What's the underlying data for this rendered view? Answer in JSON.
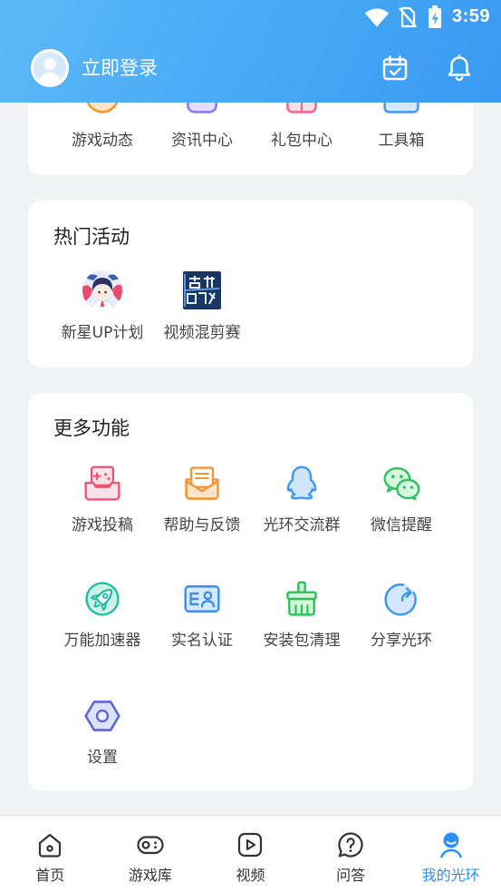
{
  "status_bar": {
    "time": "3:59",
    "icons": [
      "wifi-icon",
      "no-sim-icon",
      "battery-charging-icon"
    ]
  },
  "header": {
    "login_label": "立即登录",
    "avatar_icon": "avatar-icon",
    "right_icons": [
      "calendar-check-icon",
      "bell-icon"
    ]
  },
  "colors": {
    "header_gradient_start": "#5cb9f7",
    "header_gradient_end": "#3a9af3",
    "page_background": "#f2f3f5",
    "card_background": "#ffffff",
    "title_text": "#222222",
    "label_text": "#444444",
    "nav_active": "#2f8ff0",
    "nav_inactive": "#333333"
  },
  "quick_entries": {
    "items": [
      {
        "label": "游戏动态",
        "icon": "game-news-icon"
      },
      {
        "label": "资讯中心",
        "icon": "news-center-icon"
      },
      {
        "label": "礼包中心",
        "icon": "gift-center-icon"
      },
      {
        "label": "工具箱",
        "icon": "toolbox-icon"
      }
    ]
  },
  "hot_activities": {
    "title": "热门活动",
    "items": [
      {
        "label": "新星UP计划",
        "icon": "new-star-up-thumbnail"
      },
      {
        "label": "视频混剪赛",
        "icon": "video-remix-thumbnail"
      }
    ]
  },
  "more_features": {
    "title": "更多功能",
    "items": [
      {
        "label": "游戏投稿",
        "icon": "game-submit-icon"
      },
      {
        "label": "帮助与反馈",
        "icon": "help-feedback-icon"
      },
      {
        "label": "光环交流群",
        "icon": "group-chat-icon"
      },
      {
        "label": "微信提醒",
        "icon": "wechat-icon"
      },
      {
        "label": "万能加速器",
        "icon": "accelerator-icon"
      },
      {
        "label": "实名认证",
        "icon": "real-name-icon"
      },
      {
        "label": "安装包清理",
        "icon": "package-clean-icon"
      },
      {
        "label": "分享光环",
        "icon": "share-icon"
      },
      {
        "label": "设置",
        "icon": "settings-icon"
      }
    ]
  },
  "bottom_nav": {
    "items": [
      {
        "label": "首页",
        "icon": "home-icon",
        "active": false
      },
      {
        "label": "游戏库",
        "icon": "game-library-icon",
        "active": false
      },
      {
        "label": "视频",
        "icon": "video-icon",
        "active": false
      },
      {
        "label": "问答",
        "icon": "qa-icon",
        "active": false
      },
      {
        "label": "我的光环",
        "icon": "profile-icon",
        "active": true
      }
    ]
  }
}
